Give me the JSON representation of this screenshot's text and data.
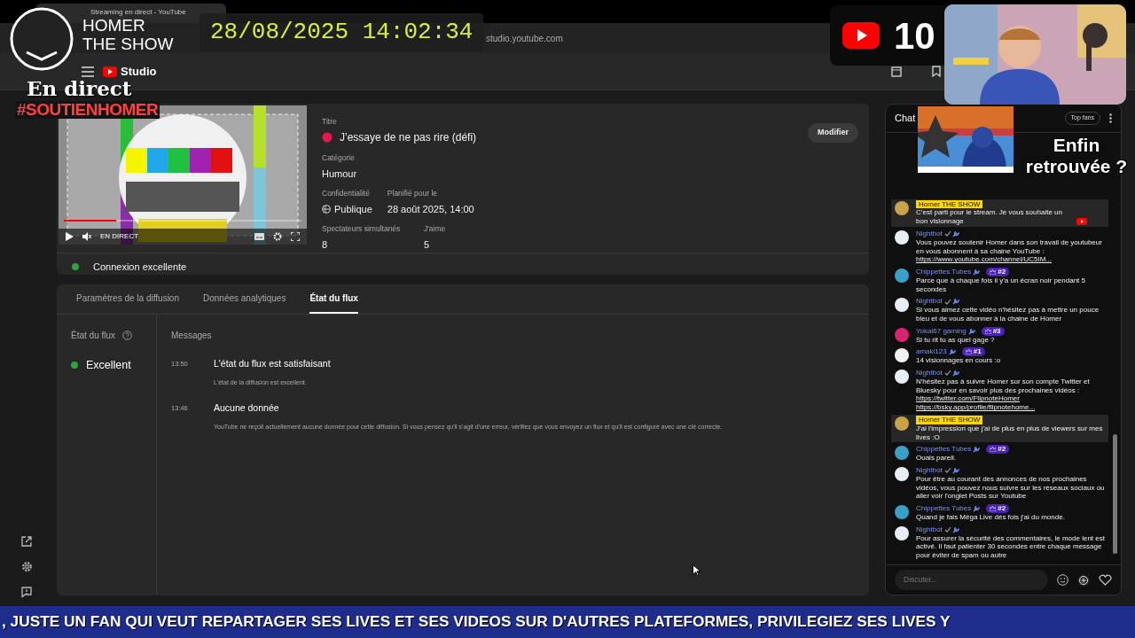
{
  "browser": {
    "tab_title": "Streaming en direct - YouTube",
    "url": "studio.youtube.com"
  },
  "overlay": {
    "channel_name": [
      "HOMER",
      "THE SHOW"
    ],
    "clock": "28/08/2025 14:02:34",
    "counter": "10",
    "live_label": "En direct",
    "hashtag": "#SOUTIENHOMER",
    "caption": "Enfin retrouvée ?",
    "ticker": ", JUSTE UN FAN QUI VEUT REPARTAGER SES LIVES ET SES VIDEOS SUR D'AUTRES PLATEFORMES, PRIVILEGIEZ SES LIVES Y"
  },
  "studio": {
    "logo_text": "Studio"
  },
  "stream": {
    "player_label": "EN DIRECT",
    "title_label": "Titre",
    "title": "J’essaye de ne pas rire (défi)",
    "category_label": "Catégorie",
    "category": "Humour",
    "privacy_label": "Confidentialité",
    "privacy": "Publique",
    "scheduled_label": "Planifié pour le",
    "scheduled": "28 août 2025, 14:00",
    "viewers_label": "Spectateurs simultanés",
    "viewers": "8",
    "likes_label": "J'aime",
    "likes": "5",
    "edit_button": "Modifier",
    "connection": "Connexion excellente"
  },
  "tabs": [
    {
      "label": "Paramètres de la diffusion",
      "selected": false
    },
    {
      "label": "Données analytiques",
      "selected": false
    },
    {
      "label": "État du flux",
      "selected": true
    }
  ],
  "health": {
    "label": "État du flux",
    "status": "Excellent",
    "messages_label": "Messages",
    "messages": [
      {
        "time": "13:50",
        "title": "L'état du flux est satisfaisant",
        "text": "L'état de la diffusion est excellent."
      },
      {
        "time": "13:46",
        "title": "Aucune donnée",
        "text": "YouTube ne reçoit actuellement aucune donnée pour cette diffusion. Si vous pensez qu'il s'agit d'une erreur, vérifiez que vous envoyez un flux et qu'il est configuré avec une clé correcte."
      }
    ]
  },
  "chat": {
    "title": "Chat",
    "top_fans": "Top fans",
    "placeholder": "Discuter...",
    "messages": [
      {
        "kind": "owner",
        "author": "Homer THE SHOW",
        "color": "#c9a24a",
        "text": "C’est parti pour le stream. Je vous souhaite un bon visionnage",
        "has_youtube_icon": true
      },
      {
        "kind": "bot",
        "author": "Nightbot",
        "color": "#e8eef5",
        "text": "Vous pouvez soutenir Homer dans son travail de youtubeur en vous abonnent à sa chaine YouTube :",
        "links": [
          "https://www.youtube.com/channel/UC5IM..."
        ]
      },
      {
        "kind": "member",
        "author": "Chippettes Tubes",
        "color": "#3aa0c8",
        "badge": "#2",
        "text": "Parce que à chaque fois il y'a un écran noir pendant 5 secondes"
      },
      {
        "kind": "bot",
        "author": "Nightbot",
        "color": "#e8eef5",
        "text": "Si vous aimez cette vidéo n'hésitez pas à mettre un pouce bleu et de vous abonner à la chaine de Homer"
      },
      {
        "kind": "member",
        "author": "Yokai67 gaming",
        "color": "#d6246e",
        "badge": "#3",
        "text": "Si tu rit tu as quel gage ?"
      },
      {
        "kind": "member",
        "author": "amaki123",
        "color": "#f2f2f2",
        "badge": "#1",
        "text": "14 visionnages en cours :o"
      },
      {
        "kind": "bot",
        "author": "Nightbot",
        "color": "#e8eef5",
        "text": "N'hésitez pas à suivre Homer sur son compte Twitter et Bluesky pour en savoir plus des prochaines vidéos :",
        "links": [
          "https://twitter.com/FlipnoteHomer",
          "https://bsky.app/profile/flipnotehome..."
        ]
      },
      {
        "kind": "owner",
        "author": "Homer THE SHOW",
        "color": "#c9a24a",
        "text": "J'ai l'impression que j'ai de plus en plus de viewers sur mes lives :O"
      },
      {
        "kind": "member",
        "author": "Chippettes Tubes",
        "color": "#3aa0c8",
        "badge": "#2",
        "text": "Ouais pareil."
      },
      {
        "kind": "bot",
        "author": "Nightbot",
        "color": "#e8eef5",
        "text": "Pour être au courant des annonces de nos prochaines vidéos, vous pouvez nous suivre sur les réseaux sociaux ou aller voir l'onglet Posts sur Youtube"
      },
      {
        "kind": "member",
        "author": "Chippettes Tubes",
        "color": "#3aa0c8",
        "badge": "#2",
        "text": "Quand je fais Méga Live dès fois j'ai du monde."
      },
      {
        "kind": "bot",
        "author": "Nightbot",
        "color": "#e8eef5",
        "text": "Pour assurer la sécurité des commentaires, le mode lent est activé. Il faut patienter 30 secondes entre chaque message pour éviter de spam ou autre"
      }
    ]
  }
}
